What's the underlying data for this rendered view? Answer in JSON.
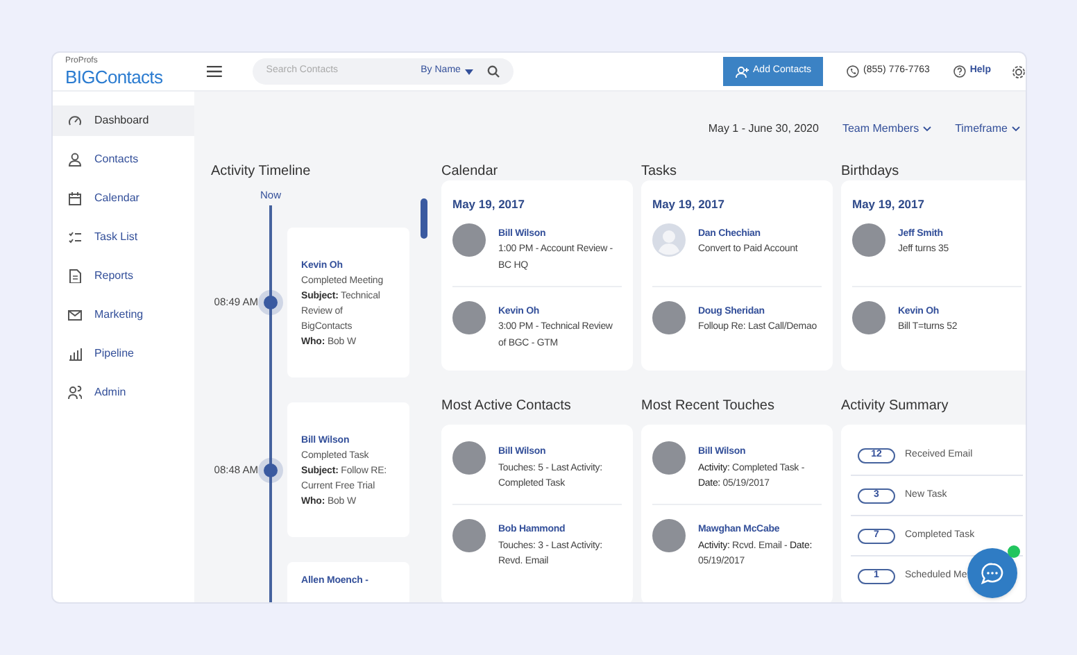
{
  "header": {
    "brand_small": "ProProfs",
    "brand": "BIGContacts",
    "search": {
      "placeholder": "Search Contacts"
    },
    "search_by": "By Name",
    "add_button": "Add Contacts",
    "phone": "(855) 776-7763",
    "help": "Help"
  },
  "sidebar": {
    "items": [
      {
        "label": "Dashboard",
        "selected": true
      },
      {
        "label": "Contacts",
        "selected": false
      },
      {
        "label": "Calendar",
        "selected": false
      },
      {
        "label": "Task List",
        "selected": false
      },
      {
        "label": "Reports",
        "selected": false
      },
      {
        "label": "Marketing",
        "selected": false
      },
      {
        "label": "Pipeline",
        "selected": false
      },
      {
        "label": "Admin",
        "selected": false
      }
    ]
  },
  "filters": {
    "date_range": "May 1 - June 30, 2020",
    "team_members": "Team Members",
    "timeframe": "Timeframe"
  },
  "timeline": {
    "title": "Activity Timeline",
    "now": "Now",
    "entries": [
      {
        "time": "08:49 AM",
        "name": "Kevin Oh",
        "lines": [
          "Completed Meeting",
          "**Subject:** Technical Review of BigContacts",
          "**Who:** Bob W"
        ]
      },
      {
        "time": "08:48 AM",
        "name": "Bill Wilson",
        "lines": [
          "Completed Task",
          "**Subject:** Follow RE: Current Free Trial",
          "**Who:** Bob W"
        ]
      },
      {
        "name": "Allen Moench -"
      }
    ]
  },
  "panels": [
    {
      "title": "Calendar",
      "date": "May 19, 2017",
      "items": [
        {
          "name": "Bill Wilson",
          "text": "1:00 PM - Account Review - BC HQ",
          "kind": "photo"
        },
        {
          "name": "Kevin Oh",
          "text": "3:00 PM - Technical Review of BGC - GTM",
          "kind": "photo"
        }
      ]
    },
    {
      "title": "Tasks",
      "date": "May 19, 2017",
      "items": [
        {
          "name": "Dan Chechian",
          "text": "Convert to Paid Account",
          "kind": "blank"
        },
        {
          "name": "Doug Sheridan",
          "text": "Folloup Re: Last Call/Demao",
          "kind": "photo"
        }
      ]
    },
    {
      "title": "Birthdays",
      "date": "May 19, 2017",
      "items": [
        {
          "name": "Jeff Smith",
          "text": "Jeff turns 35",
          "kind": "photo"
        },
        {
          "name": "Kevin Oh",
          "text": "Bill T=turns 52",
          "kind": "photo"
        }
      ]
    },
    {
      "title": "Most Active Contacts",
      "items": [
        {
          "name": "Bill Wilson",
          "text": "Touches: 5 - Last Activity: Completed Task",
          "kind": "photo"
        },
        {
          "name": "Bob Hammond",
          "text": "Touches: 3 - Last Activity: Revd. Email",
          "kind": "photo"
        }
      ]
    },
    {
      "title": "Most Recent Touches",
      "items": [
        {
          "name": "Bill Wilson",
          "text": "**Activity:** Completed Task - **Date:** 05/19/2017",
          "kind": "photo"
        },
        {
          "name": "Mawghan McCabe",
          "text": "**Activity:** Rcvd. Email - **Date:** 05/19/2017",
          "kind": "photo"
        }
      ]
    }
  ],
  "activity_summary": {
    "title": "Activity Summary",
    "items": [
      {
        "count": "12",
        "label": "Received Email"
      },
      {
        "count": "3",
        "label": "New Task"
      },
      {
        "count": "7",
        "label": "Completed Task"
      },
      {
        "count": "1",
        "label": "Scheduled Me"
      }
    ]
  },
  "chat": {
    "online": true
  }
}
